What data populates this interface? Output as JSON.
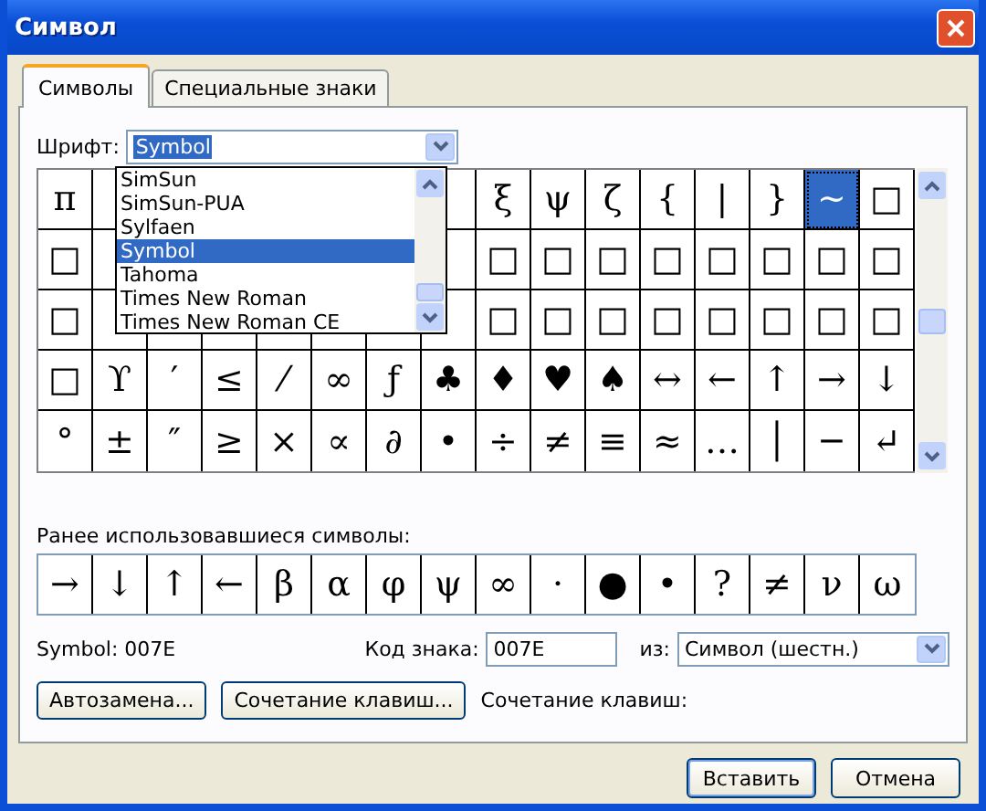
{
  "window": {
    "title": "Символ"
  },
  "tabs": [
    {
      "label": "Символы",
      "selected": true
    },
    {
      "label": "Специальные знаки",
      "selected": false
    }
  ],
  "font": {
    "label": "Шрифт:",
    "value": "Symbol",
    "options": [
      {
        "label": "SimSun",
        "selected": false
      },
      {
        "label": "SimSun-PUA",
        "selected": false
      },
      {
        "label": "Sylfaen",
        "selected": false
      },
      {
        "label": "Symbol",
        "selected": true
      },
      {
        "label": "Tahoma",
        "selected": false
      },
      {
        "label": "Times New Roman",
        "selected": false
      },
      {
        "label": "Times New Roman CE",
        "selected": false
      }
    ]
  },
  "grid": [
    {
      "left": [
        {
          "c": "π",
          "selected": false
        }
      ],
      "right": [
        {
          "c": "ξ",
          "selected": false
        },
        {
          "c": "ψ",
          "selected": false
        },
        {
          "c": "ζ",
          "selected": false
        },
        {
          "c": "{",
          "selected": false
        },
        {
          "c": "|",
          "selected": false
        },
        {
          "c": "}",
          "selected": false
        },
        {
          "c": "~",
          "selected": true
        },
        {
          "c": "□",
          "selected": false
        }
      ]
    },
    {
      "left": [
        {
          "c": "□",
          "selected": false
        }
      ],
      "right": [
        {
          "c": "□",
          "selected": false
        },
        {
          "c": "□",
          "selected": false
        },
        {
          "c": "□",
          "selected": false
        },
        {
          "c": "□",
          "selected": false
        },
        {
          "c": "□",
          "selected": false
        },
        {
          "c": "□",
          "selected": false
        },
        {
          "c": "□",
          "selected": false
        },
        {
          "c": "□",
          "selected": false
        }
      ]
    },
    {
      "left": [
        {
          "c": "□",
          "selected": false
        }
      ],
      "right": [
        {
          "c": "□",
          "selected": false
        },
        {
          "c": "□",
          "selected": false
        },
        {
          "c": "□",
          "selected": false
        },
        {
          "c": "□",
          "selected": false
        },
        {
          "c": "□",
          "selected": false
        },
        {
          "c": "□",
          "selected": false
        },
        {
          "c": "□",
          "selected": false
        },
        {
          "c": "□",
          "selected": false
        }
      ]
    },
    {
      "left": [
        {
          "c": "□",
          "selected": false
        },
        {
          "c": "ϒ",
          "selected": false
        },
        {
          "c": "′",
          "selected": false
        },
        {
          "c": "≤",
          "selected": false
        },
        {
          "c": "⁄",
          "selected": false
        },
        {
          "c": "∞",
          "selected": false
        },
        {
          "c": "ƒ",
          "selected": false
        },
        {
          "c": "♣",
          "selected": false
        },
        {
          "c": "♦",
          "selected": false
        },
        {
          "c": "♥",
          "selected": false
        },
        {
          "c": "♠",
          "selected": false
        },
        {
          "c": "↔",
          "selected": false
        },
        {
          "c": "←",
          "selected": false
        },
        {
          "c": "↑",
          "selected": false
        },
        {
          "c": "→",
          "selected": false
        },
        {
          "c": "↓",
          "selected": false
        }
      ]
    },
    {
      "left": [
        {
          "c": "°",
          "selected": false
        },
        {
          "c": "±",
          "selected": false
        },
        {
          "c": "″",
          "selected": false
        },
        {
          "c": "≥",
          "selected": false
        },
        {
          "c": "×",
          "selected": false
        },
        {
          "c": "∝",
          "selected": false
        },
        {
          "c": "∂",
          "selected": false
        },
        {
          "c": "•",
          "selected": false
        },
        {
          "c": "÷",
          "selected": false
        },
        {
          "c": "≠",
          "selected": false
        },
        {
          "c": "≡",
          "selected": false
        },
        {
          "c": "≈",
          "selected": false
        },
        {
          "c": "…",
          "selected": false
        },
        {
          "c": "│",
          "selected": false
        },
        {
          "c": "─",
          "selected": false
        },
        {
          "c": "↵",
          "selected": false
        }
      ]
    }
  ],
  "recent": {
    "label": "Ранее использовавшиеся символы:",
    "symbols": [
      "→",
      "↓",
      "↑",
      "←",
      "β",
      "α",
      "φ",
      "ψ",
      "∞",
      "·",
      "●",
      "•",
      "?",
      "≠",
      "ν",
      "ω"
    ]
  },
  "char_name": "Symbol: 007E",
  "code": {
    "label": "Код знака:",
    "value": "007E"
  },
  "from": {
    "label": "из:",
    "value": "Символ (шестн.)"
  },
  "autocorrect_button": "Автозамена...",
  "shortcut_button": "Сочетание клавиш...",
  "shortcut_label": "Сочетание клавиш:",
  "buttons": [
    "Вставить",
    "Отмена"
  ]
}
